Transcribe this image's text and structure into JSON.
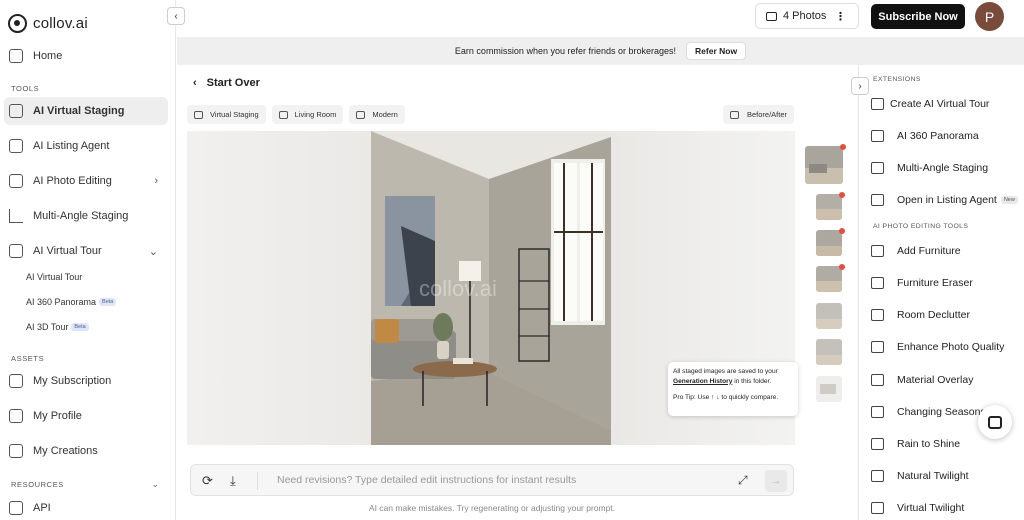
{
  "app": {
    "name": "collov.ai"
  },
  "sidebar": {
    "home": "Home",
    "sections": {
      "tools": "TOOLS",
      "assets": "ASSETS",
      "resources": "RESOURCES"
    },
    "tools": [
      {
        "label": "AI Virtual Staging",
        "icon": "virtual-staging-icon",
        "active": true
      },
      {
        "label": "AI Listing Agent",
        "icon": "listing-agent-icon"
      },
      {
        "label": "AI Photo Editing",
        "icon": "photo-editing-icon",
        "caret": "›"
      },
      {
        "label": "Multi-Angle Staging",
        "icon": "multi-angle-icon"
      },
      {
        "label": "AI Virtual Tour",
        "icon": "virtual-tour-icon",
        "caret": "⌄"
      }
    ],
    "virtual_tour_sub": [
      {
        "label": "AI Virtual Tour"
      },
      {
        "label": "AI 360 Panorama",
        "badge": "Beta"
      },
      {
        "label": "AI 3D Tour",
        "badge": "Beta"
      }
    ],
    "assets": [
      {
        "label": "My Subscription",
        "icon": "subscription-icon"
      },
      {
        "label": "My Profile",
        "icon": "profile-icon"
      },
      {
        "label": "My Creations",
        "icon": "creations-icon"
      }
    ],
    "resources": [
      {
        "label": "API",
        "icon": "api-icon"
      }
    ]
  },
  "topbar": {
    "photos_label": "4 Photos",
    "subscribe_label": "Subscribe Now",
    "avatar_initial": "P"
  },
  "banner": {
    "text": "Earn commission when you refer friends or brokerages!",
    "button": "Refer Now"
  },
  "main": {
    "start_over": "Start Over",
    "chips": [
      "Virtual Staging",
      "Living Room",
      "Modern"
    ],
    "before_after": "Before/After",
    "watermark": "collov.ai",
    "tooltip": {
      "line1": "All staged images are saved to your",
      "link": "Generation History",
      "line2": "in this folder.",
      "tip": "Pro Tip: Use ↑ ↓ to quickly compare."
    },
    "prompt_placeholder": "Need revisions? Type detailed edit instructions for instant results",
    "disclaimer": "AI can make mistakes. Try regenerating or adjusting your prompt."
  },
  "right_panel": {
    "extensions_label": "EXTENSIONS",
    "extensions": [
      {
        "label": "Create AI Virtual Tour",
        "icon": "virtual-tour-icon"
      },
      {
        "label": "AI 360 Panorama",
        "icon": "panorama-icon"
      },
      {
        "label": "Multi-Angle Staging",
        "icon": "multi-angle-icon"
      },
      {
        "label": "Open in Listing Agent",
        "icon": "listing-agent-icon",
        "badge": "New"
      }
    ],
    "editing_label": "AI PHOTO EDITING TOOLS",
    "editing_tools": [
      {
        "label": "Add Furniture",
        "icon": "sofa-icon"
      },
      {
        "label": "Furniture Eraser",
        "icon": "eraser-icon"
      },
      {
        "label": "Room Declutter",
        "icon": "box-icon"
      },
      {
        "label": "Enhance Photo Quality",
        "icon": "enhance-icon"
      },
      {
        "label": "Material Overlay",
        "icon": "bucket-icon"
      },
      {
        "label": "Changing Seasons",
        "icon": "snowflake-icon"
      },
      {
        "label": "Rain to Shine",
        "icon": "cloud-icon"
      },
      {
        "label": "Natural Twilight",
        "icon": "sunset-icon"
      },
      {
        "label": "Virtual Twilight",
        "icon": "moon-icon"
      }
    ]
  }
}
